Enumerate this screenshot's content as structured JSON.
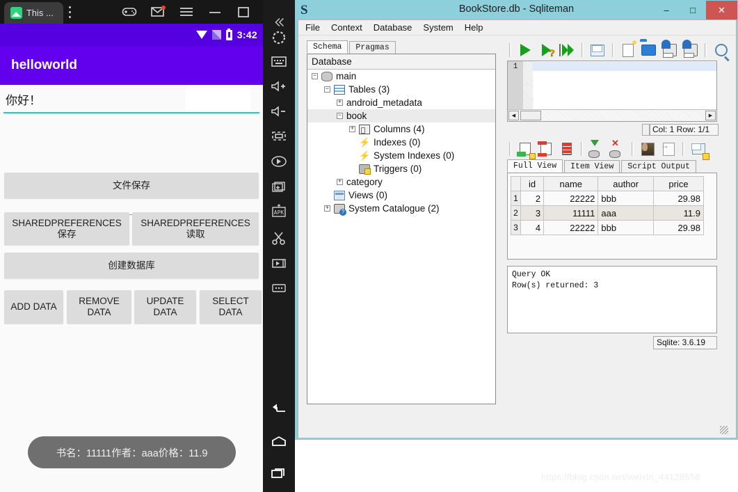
{
  "emulator": {
    "tab_label": "This ...",
    "tab_icon": "app-icon",
    "kebab_icon": "more-vertical-icon",
    "titlebar_icons": [
      "gamepad-icon",
      "mail-icon",
      "hamburger-menu-icon",
      "minimize-icon",
      "maximize-icon",
      "close-icon"
    ],
    "collapse_icon": "double-chevron-left-icon",
    "status_bar": {
      "clock": "3:42",
      "wifi_icon": "wifi-icon",
      "signal_icon": "cell-signal-icon",
      "battery_icon": "battery-charging-icon"
    },
    "app_title": "helloworld",
    "edit_text_value": "你好！",
    "buttons": {
      "file_save": "文件保存",
      "sp_save_line1": "SHAREDPREFERENCES",
      "sp_save_line2": "保存",
      "sp_read_line1": "SHAREDPREFERENCES",
      "sp_read_line2": "读取",
      "create_db": "创建数据库",
      "add_data": "ADD DATA",
      "remove_data_line1": "REMOVE",
      "remove_data_line2": "DATA",
      "update_data_line1": "UPDATE",
      "update_data_line2": "DATA",
      "select_data_line1": "SELECT",
      "select_data_line2": "DATA"
    },
    "toast": "书名：11111作者：aaa价格：11.9",
    "sidebar_icons": [
      "collapse-icon",
      "power-icon",
      "keyboard-icon",
      "volume-up-icon",
      "volume-down-icon",
      "rotate-icon",
      "screenshot-icon",
      "add-screen-icon",
      "install-apk-icon",
      "scissors-icon",
      "record-icon",
      "more-icon",
      "back-nav-icon",
      "home-nav-icon",
      "recents-nav-icon"
    ]
  },
  "sqliteman": {
    "title": "BookStore.db - Sqliteman",
    "logo_icon": "sqliteman-logo-icon",
    "window_buttons": {
      "minimize": "–",
      "maximize": "□",
      "close": "✕"
    },
    "menu": [
      "File",
      "Context",
      "Database",
      "System",
      "Help"
    ],
    "left_tabs": [
      {
        "label": "Schema",
        "active": true
      },
      {
        "label": "Pragmas",
        "active": false
      }
    ],
    "tree_header": "Database",
    "tree": [
      {
        "label": "main",
        "icon": "database-icon",
        "indent": 0,
        "expander": "-",
        "selected": false
      },
      {
        "label": "Tables (3)",
        "icon": "table-icon",
        "indent": 1,
        "expander": "-",
        "selected": false
      },
      {
        "label": "android_metadata",
        "icon": "",
        "indent": 2,
        "expander": "+",
        "selected": false
      },
      {
        "label": "book",
        "icon": "",
        "indent": 2,
        "expander": "-",
        "selected": true
      },
      {
        "label": "Columns (4)",
        "icon": "column-icon",
        "indent": 3,
        "expander": "+",
        "selected": false
      },
      {
        "label": "Indexes (0)",
        "icon": "index-icon",
        "indent": 3,
        "expander": "",
        "selected": false
      },
      {
        "label": "System Indexes (0)",
        "icon": "index-icon",
        "indent": 3,
        "expander": "",
        "selected": false
      },
      {
        "label": "Triggers (0)",
        "icon": "trigger-icon",
        "indent": 3,
        "expander": "",
        "selected": false
      },
      {
        "label": "category",
        "icon": "",
        "indent": 2,
        "expander": "+",
        "selected": false
      },
      {
        "label": "Views (0)",
        "icon": "view-icon",
        "indent": 1,
        "expander": "",
        "selected": false
      },
      {
        "label": "System Catalogue (2)",
        "icon": "catalogue-icon",
        "indent": 1,
        "expander": "+",
        "selected": false
      }
    ],
    "sql_toolbar_icons": [
      "run-sql-icon",
      "run-explain-icon",
      "run-all-icon",
      "create-view-icon",
      "new-sql-icon",
      "open-sql-icon",
      "save-sql-icon",
      "save-sql-as-icon",
      "find-icon"
    ],
    "editor_line_number": "1",
    "editor_value": "",
    "col_row_status": "Col: 1 Row: 1/1",
    "result_toolbar_icons": [
      "insert-row-icon",
      "delete-row-icon",
      "truncate-table-icon",
      "commit-icon",
      "rollback-icon",
      "view-blob-icon",
      "export-icon",
      "new-table-icon"
    ],
    "result_tabs": [
      {
        "label": "Full View",
        "active": true
      },
      {
        "label": "Item View",
        "active": false
      },
      {
        "label": "Script Output",
        "active": false
      }
    ],
    "result_table": {
      "columns": [
        "id",
        "name",
        "author",
        "price"
      ],
      "rows": [
        {
          "n": "1",
          "id": "2",
          "name": "22222",
          "author": "bbb",
          "price": "29.98"
        },
        {
          "n": "2",
          "id": "3",
          "name": "11111",
          "author": "aaa",
          "price": "11.9"
        },
        {
          "n": "3",
          "id": "4",
          "name": "22222",
          "author": "bbb",
          "price": "29.98"
        }
      ]
    },
    "output_text": "Query OK\nRow(s) returned: 3",
    "status_bar": "Sqlite: 3.6.19"
  },
  "watermark": "https://blog.csdn.net/weixin_44128558"
}
